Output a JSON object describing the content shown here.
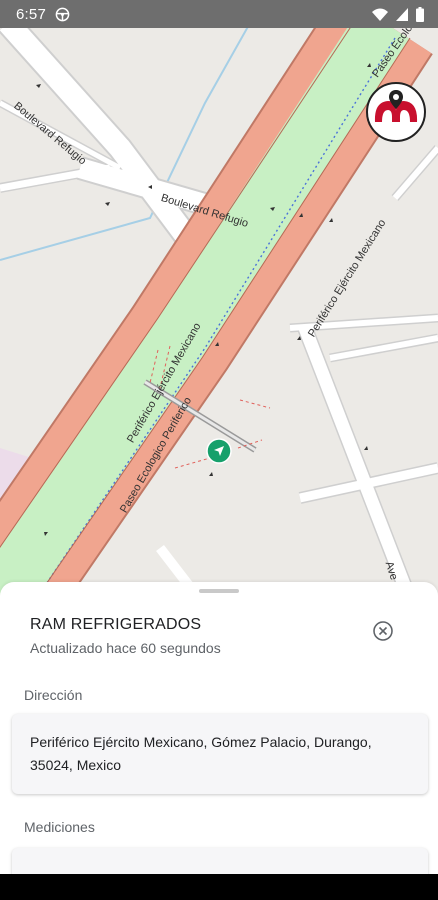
{
  "status_bar": {
    "time": "6:57",
    "icons": [
      "steering-wheel-icon",
      "wifi-icon",
      "signal-icon",
      "battery-icon"
    ]
  },
  "map": {
    "labels": {
      "boulevard_refugio_1": "Boulevard Refugio",
      "boulevard_refugio_2": "Boulevard Refugio",
      "periferico_1": "Periférico Ejército Mexicano",
      "periferico_2": "Periférico Ejército Mexicano",
      "paseo_ecologico_1": "Paseo Ecologico Periferico",
      "paseo_ecologico_2": "Paseo Ecolo",
      "avenida_partial": "Ave"
    },
    "marker_icon": "navigation-arrow-icon",
    "marker_color": "#16a06b",
    "logo_icon": "brand-logo-icon"
  },
  "sheet": {
    "vehicle_name": "RAM REFRIGERADOS",
    "updated": "Actualizado hace 60 segundos",
    "address_label": "Dirección",
    "address": "Periférico Ejército Mexicano, Gómez Palacio, Durango, 35024, Mexico",
    "measurements_label": "Mediciones"
  },
  "colors": {
    "road_red": "#f0a58f",
    "green_strip": "#c8f0c4",
    "map_background": "#eceae6",
    "logo_red": "#c8102e"
  }
}
